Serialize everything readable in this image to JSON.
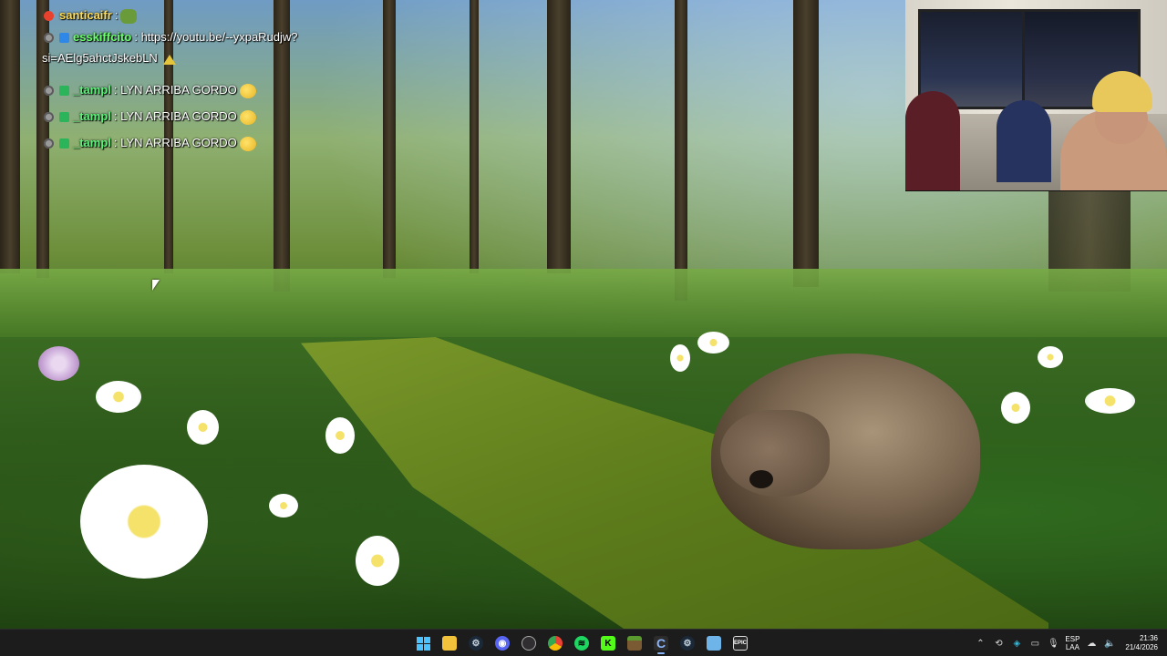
{
  "chat": {
    "messages": [
      {
        "user": "santicaifr",
        "separator": ":",
        "text": ""
      },
      {
        "user": "esskiffcito",
        "separator": ":",
        "text": "https://youtu.be/--yxpaRudjw?",
        "text2": "si=AElg5ahctJskebLN"
      },
      {
        "user": "_tampl",
        "separator": " :",
        "text": "LYN ARRIBA GORDO"
      },
      {
        "user": "_tampl",
        "separator": " :",
        "text": "LYN ARRIBA GORDO"
      },
      {
        "user": "_tampl",
        "separator": " :",
        "text": "LYN ARRIBA GORDO"
      }
    ]
  },
  "taskbar": {
    "icons": [
      {
        "name": "start",
        "label": "Start"
      },
      {
        "name": "file-explorer",
        "label": "File Explorer"
      },
      {
        "name": "steam",
        "label": "Steam"
      },
      {
        "name": "discord",
        "label": "Discord"
      },
      {
        "name": "obs",
        "label": "OBS"
      },
      {
        "name": "chrome",
        "label": "Chrome"
      },
      {
        "name": "spotify",
        "label": "Spotify"
      },
      {
        "name": "kick",
        "label": "Kick"
      },
      {
        "name": "minecraft",
        "label": "Minecraft"
      },
      {
        "name": "chatterino",
        "label": "Chatterino"
      },
      {
        "name": "steam-2",
        "label": "Steam"
      },
      {
        "name": "notepad",
        "label": "Notepad"
      },
      {
        "name": "epic-games",
        "label": "EPIC"
      }
    ],
    "tray": {
      "lang_top": "ESP",
      "lang_bottom": "LAA",
      "time": "21:36",
      "date": "21/4/2026"
    }
  },
  "colors": {
    "taskbar_bg": "#1c1c1c",
    "accent": "#4cc2ff"
  }
}
